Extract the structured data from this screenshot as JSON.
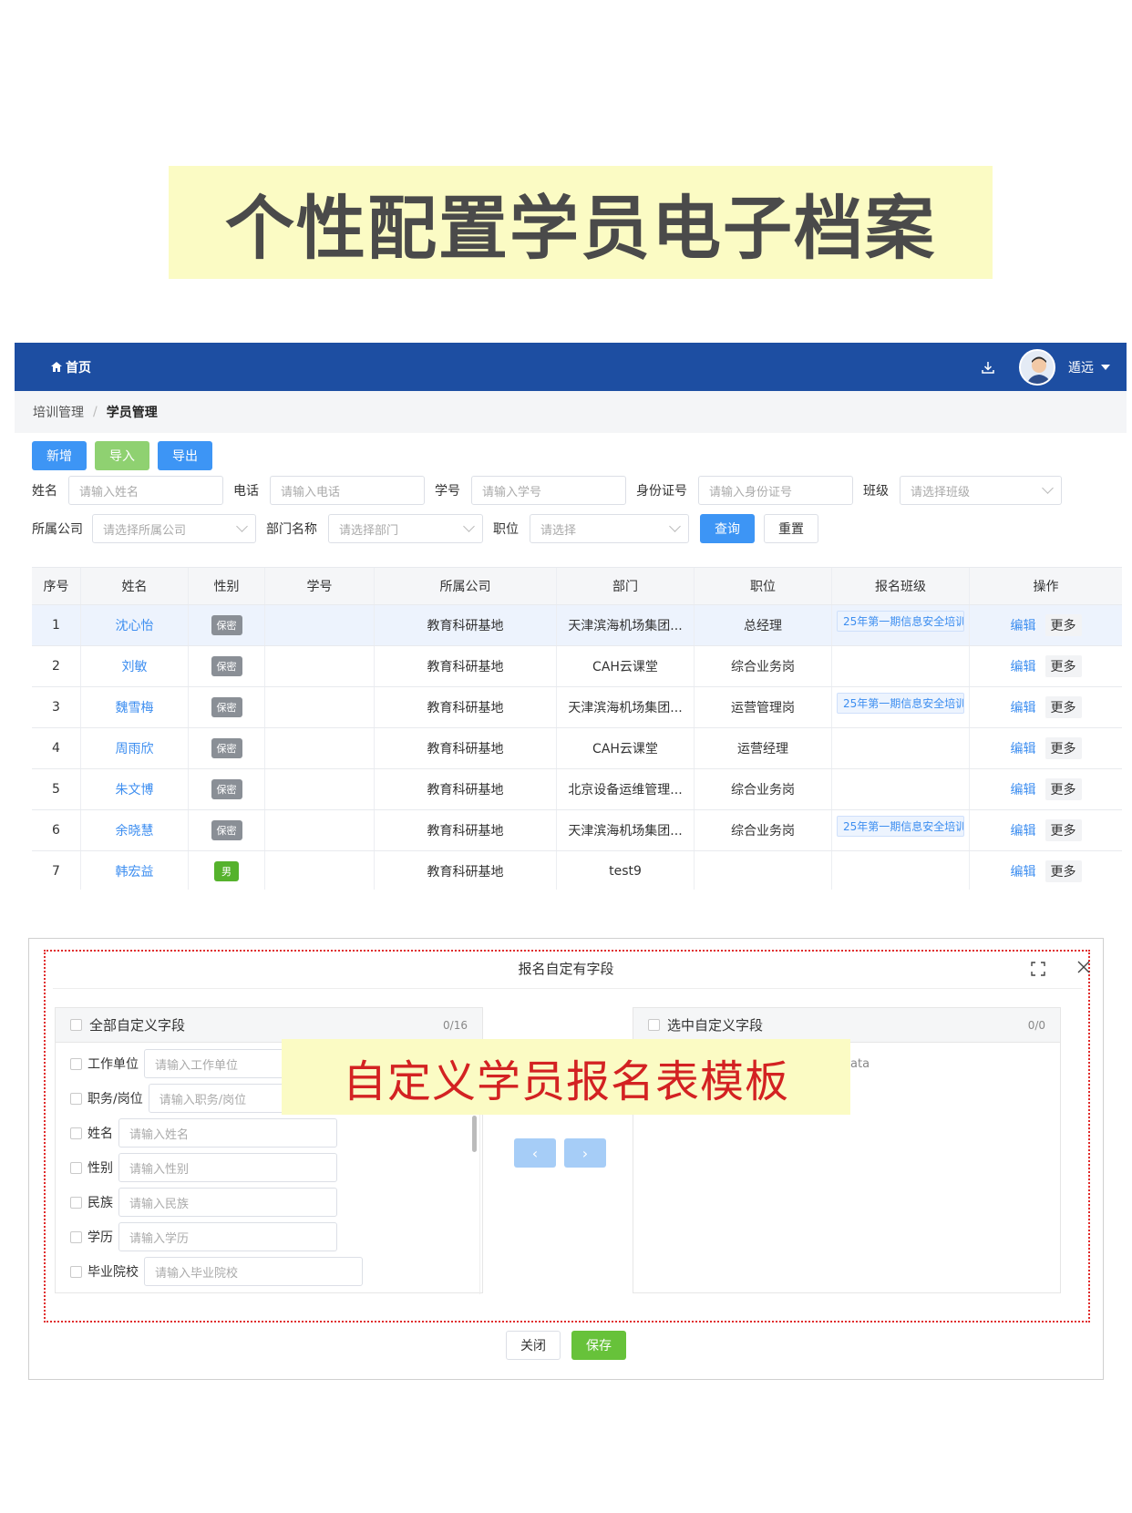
{
  "banner": {
    "title": "个性配置学员电子档案"
  },
  "header": {
    "home_label": "首页",
    "user_name": "遁远"
  },
  "breadcrumb": {
    "parent": "培训管理",
    "separator": "/",
    "current": "学员管理"
  },
  "toolbar": {
    "add": "新增",
    "import": "导入",
    "export": "导出"
  },
  "filters": {
    "name_label": "姓名",
    "name_ph": "请输入姓名",
    "phone_label": "电话",
    "phone_ph": "请输入电话",
    "sid_label": "学号",
    "sid_ph": "请输入学号",
    "idcard_label": "身份证号",
    "idcard_ph": "请输入身份证号",
    "class_label": "班级",
    "class_ph": "请选择班级",
    "company_label": "所属公司",
    "company_ph": "请选择所属公司",
    "dept_label": "部门名称",
    "dept_ph": "请选择部门",
    "pos_label": "职位",
    "pos_ph": "请选择",
    "query": "查询",
    "reset": "重置"
  },
  "table": {
    "headers": [
      "序号",
      "姓名",
      "性别",
      "学号",
      "所属公司",
      "部门",
      "职位",
      "报名班级",
      "操作"
    ],
    "edit_label": "编辑",
    "more_label": "更多",
    "rows": [
      {
        "no": "1",
        "name": "沈心怡",
        "gender": "保密",
        "sid": "",
        "company": "教育科研基地",
        "dept": "天津滨海机场集团...",
        "pos": "总经理",
        "cls": "25年第一期信息安全培训"
      },
      {
        "no": "2",
        "name": "刘敏",
        "gender": "保密",
        "sid": "",
        "company": "教育科研基地",
        "dept": "CAH云课堂",
        "pos": "综合业务岗",
        "cls": ""
      },
      {
        "no": "3",
        "name": "魏雪梅",
        "gender": "保密",
        "sid": "",
        "company": "教育科研基地",
        "dept": "天津滨海机场集团...",
        "pos": "运营管理岗",
        "cls": "25年第一期信息安全培训"
      },
      {
        "no": "4",
        "name": "周雨欣",
        "gender": "保密",
        "sid": "",
        "company": "教育科研基地",
        "dept": "CAH云课堂",
        "pos": "运营经理",
        "cls": ""
      },
      {
        "no": "5",
        "name": "朱文博",
        "gender": "保密",
        "sid": "",
        "company": "教育科研基地",
        "dept": "北京设备运维管理...",
        "pos": "综合业务岗",
        "cls": ""
      },
      {
        "no": "6",
        "name": "余晓慧",
        "gender": "保密",
        "sid": "",
        "company": "教育科研基地",
        "dept": "天津滨海机场集团...",
        "pos": "综合业务岗",
        "cls": "25年第一期信息安全培训"
      },
      {
        "no": "7",
        "name": "韩宏益",
        "gender": "男",
        "sid": "",
        "company": "教育科研基地",
        "dept": "test9",
        "pos": "",
        "cls": ""
      }
    ]
  },
  "modal": {
    "title": "报名自定有字段",
    "left_title": "全部自定义字段",
    "left_count": "0/16",
    "right_title": "选中自定义字段",
    "right_count": "0/0",
    "right_empty": "ata",
    "fields": [
      {
        "label": "工作单位",
        "ph": "请输入工作单位"
      },
      {
        "label": "职务/岗位",
        "ph": "请输入职务/岗位"
      },
      {
        "label": "姓名",
        "ph": "请输入姓名"
      },
      {
        "label": "性别",
        "ph": "请输入性别"
      },
      {
        "label": "民族",
        "ph": "请输入民族"
      },
      {
        "label": "学历",
        "ph": "请输入学历"
      },
      {
        "label": "毕业院校",
        "ph": "请输入毕业院校"
      }
    ],
    "arrow_left": "‹",
    "arrow_right": "›",
    "close": "关闭",
    "save": "保存",
    "overlay": "自定义学员报名表模板"
  },
  "colors": {
    "nav": "#1d4ea2",
    "primary": "#3d95f5",
    "success": "#67c23a",
    "highlight": "#fbfbc4",
    "accent_red": "#d32222"
  }
}
